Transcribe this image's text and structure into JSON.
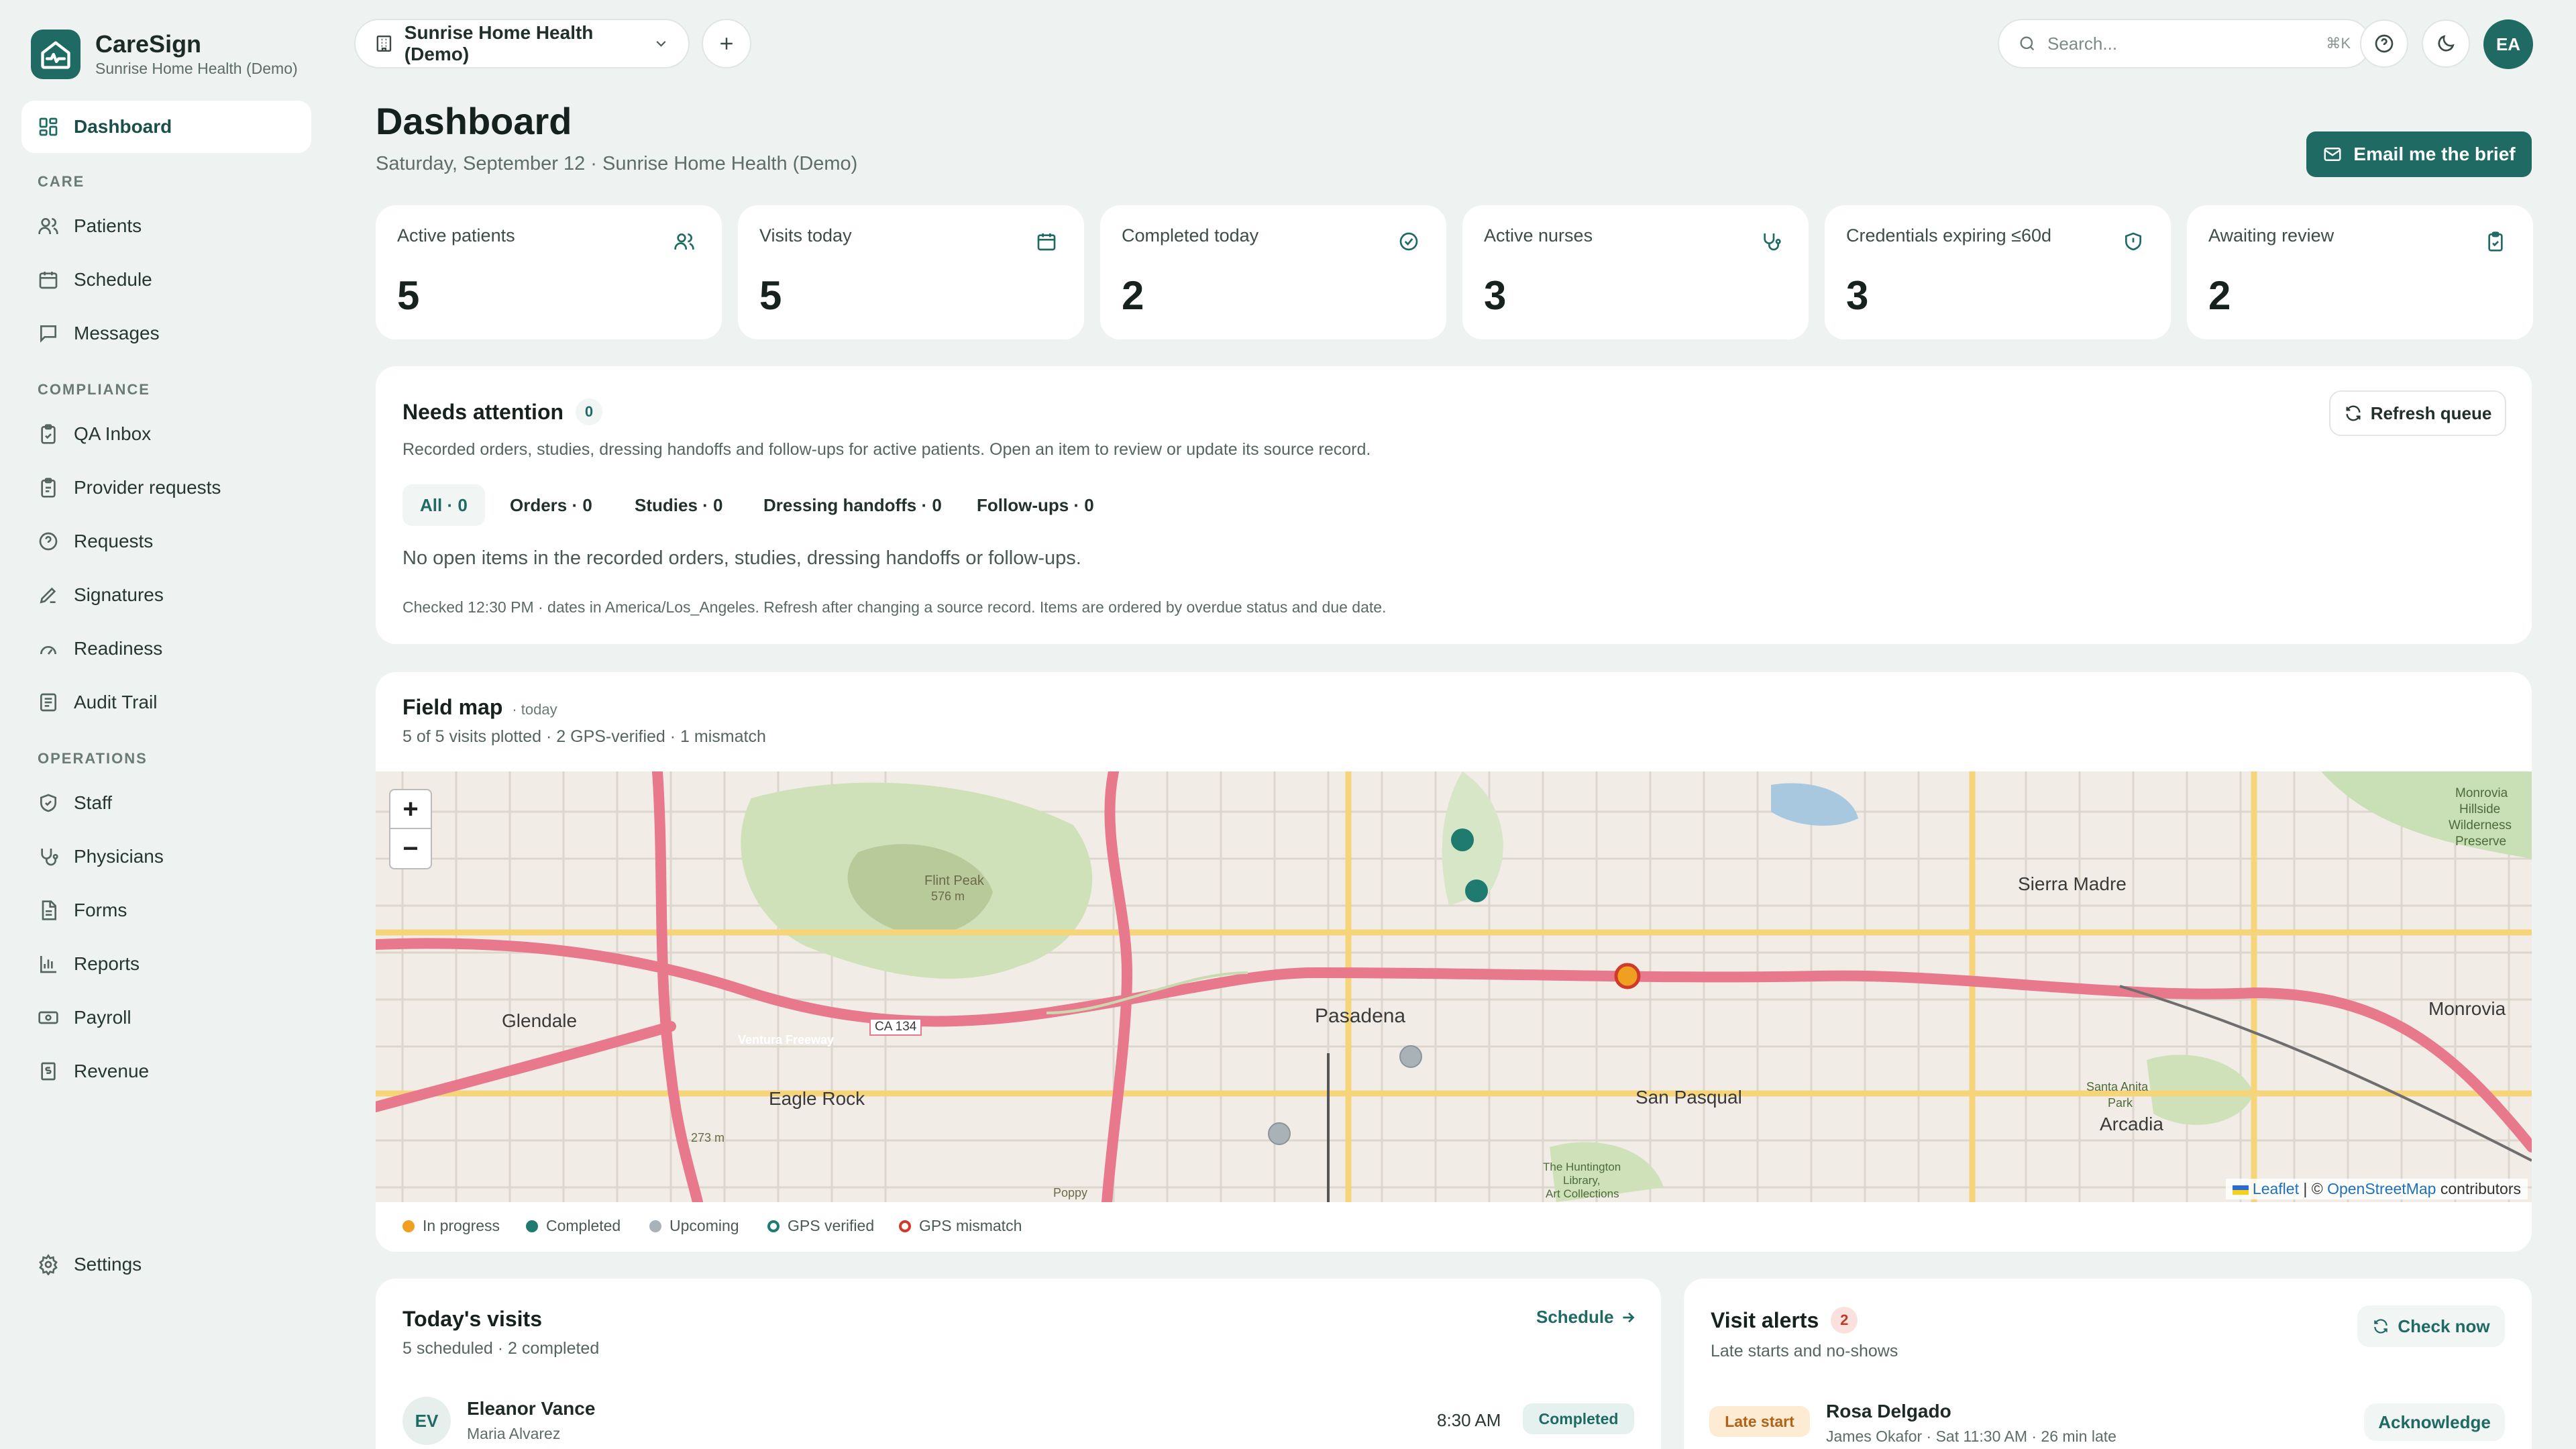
{
  "brand": {
    "name": "CareSign",
    "org": "Sunrise Home Health (Demo)"
  },
  "sidebar": {
    "dashboard": "Dashboard",
    "sections": {
      "care": "CARE",
      "compliance": "COMPLIANCE",
      "operations": "OPERATIONS"
    },
    "care": [
      {
        "label": "Patients",
        "icon": "users-icon"
      },
      {
        "label": "Schedule",
        "icon": "calendar-icon"
      },
      {
        "label": "Messages",
        "icon": "message-icon"
      }
    ],
    "compliance": [
      {
        "label": "QA Inbox",
        "icon": "clipboard-check-icon"
      },
      {
        "label": "Provider requests",
        "icon": "clipboard-icon"
      },
      {
        "label": "Requests",
        "icon": "help-circle-icon"
      },
      {
        "label": "Signatures",
        "icon": "pen-icon"
      },
      {
        "label": "Readiness",
        "icon": "gauge-icon"
      },
      {
        "label": "Audit Trail",
        "icon": "list-icon"
      }
    ],
    "operations": [
      {
        "label": "Staff",
        "icon": "shield-icon"
      },
      {
        "label": "Physicians",
        "icon": "stethoscope-icon"
      },
      {
        "label": "Forms",
        "icon": "file-icon"
      },
      {
        "label": "Reports",
        "icon": "bar-chart-icon"
      },
      {
        "label": "Payroll",
        "icon": "banknote-icon"
      },
      {
        "label": "Revenue",
        "icon": "receipt-icon"
      }
    ],
    "settings": "Settings"
  },
  "topbar": {
    "org_selector": "Sunrise Home Health (Demo)",
    "search_placeholder": "Search...",
    "search_shortcut": "⌘K",
    "avatar_initials": "EA"
  },
  "header": {
    "title": "Dashboard",
    "subtitle": "Saturday, September 12 · Sunrise Home Health (Demo)",
    "email_brief": "Email me the brief"
  },
  "stats": [
    {
      "label": "Active patients",
      "value": "5",
      "icon": "users-icon"
    },
    {
      "label": "Visits today",
      "value": "5",
      "icon": "calendar-icon"
    },
    {
      "label": "Completed today",
      "value": "2",
      "icon": "check-circle-icon"
    },
    {
      "label": "Active nurses",
      "value": "3",
      "icon": "stethoscope-icon"
    },
    {
      "label": "Credentials expiring ≤60d",
      "value": "3",
      "icon": "shield-icon"
    },
    {
      "label": "Awaiting review",
      "value": "2",
      "icon": "clipboard-check-icon"
    }
  ],
  "attention": {
    "title": "Needs attention",
    "count": "0",
    "description": "Recorded orders, studies, dressing handoffs and follow-ups for active patients. Open an item to review or update its source record.",
    "refresh": "Refresh queue",
    "tabs": [
      "All · 0",
      "Orders · 0",
      "Studies · 0",
      "Dressing handoffs · 0",
      "Follow-ups · 0"
    ],
    "empty": "No open items in the recorded orders, studies, dressing handoffs or follow-ups.",
    "footnote": "Checked 12:30 PM · dates in America/Los_Angeles. Refresh after changing a source record. Items are ordered by overdue status and due date."
  },
  "field_map": {
    "title": "Field map",
    "when": "· today",
    "summary": "5 of 5 visits plotted · 2 GPS-verified · 1 mismatch",
    "zoom_in": "+",
    "zoom_out": "−",
    "labels": {
      "flint_peak": "Flint Peak",
      "flint_peak_elev": "576 m",
      "glendale": "Glendale",
      "pasadena": "Pasadena",
      "eagle_rock": "Eagle Rock",
      "san_pasqual": "San Pasqual",
      "sierra_madre": "Sierra Madre",
      "arcadia": "Arcadia",
      "monrovia": "Monrovia",
      "ventura_fwy": "Ventura Freeway",
      "ca134": "CA 134",
      "santa_anita": "Santa Anita",
      "park": "Park",
      "monrovia_hillside": "Monrovia",
      "hillside": "Hillside",
      "wilderness": "Wilderness",
      "preserve": "Preserve",
      "huntington1": "The Huntington",
      "huntington2": "Library,",
      "huntington3": "Art Collections",
      "elev273": "273 m",
      "poppy": "Poppy"
    },
    "attribution": {
      "leaflet": "Leaflet",
      "sep": " | © ",
      "osm": "OpenStreetMap",
      "contrib": " contributors"
    },
    "legend": [
      {
        "label": "In progress",
        "color": "#f0a020",
        "ring": false
      },
      {
        "label": "Completed",
        "color": "#1f7a70",
        "ring": false
      },
      {
        "label": "Upcoming",
        "color": "#a8b2b7",
        "ring": false
      },
      {
        "label": "GPS verified",
        "color": "#1f7a70",
        "ring": true
      },
      {
        "label": "GPS mismatch",
        "color": "#d03a2b",
        "ring": true
      }
    ]
  },
  "todays_visits": {
    "title": "Today's visits",
    "summary": "5 scheduled · 2 completed",
    "schedule_link": "Schedule",
    "rows": [
      {
        "initials": "EV",
        "patient": "Eleanor Vance",
        "nurse": "Maria Alvarez",
        "time": "8:30 AM",
        "status": "Completed"
      }
    ]
  },
  "visit_alerts": {
    "title": "Visit alerts",
    "count": "2",
    "subtitle": "Late starts and no-shows",
    "check_now": "Check now",
    "rows": [
      {
        "tag": "Late start",
        "patient": "Rosa Delgado",
        "detail": "James Okafor · Sat 11:30 AM · 26 min late",
        "action": "Acknowledge"
      }
    ]
  },
  "colors": {
    "brand": "#1f6a63",
    "background": "#eef3f1",
    "late": "#fdebd3"
  }
}
